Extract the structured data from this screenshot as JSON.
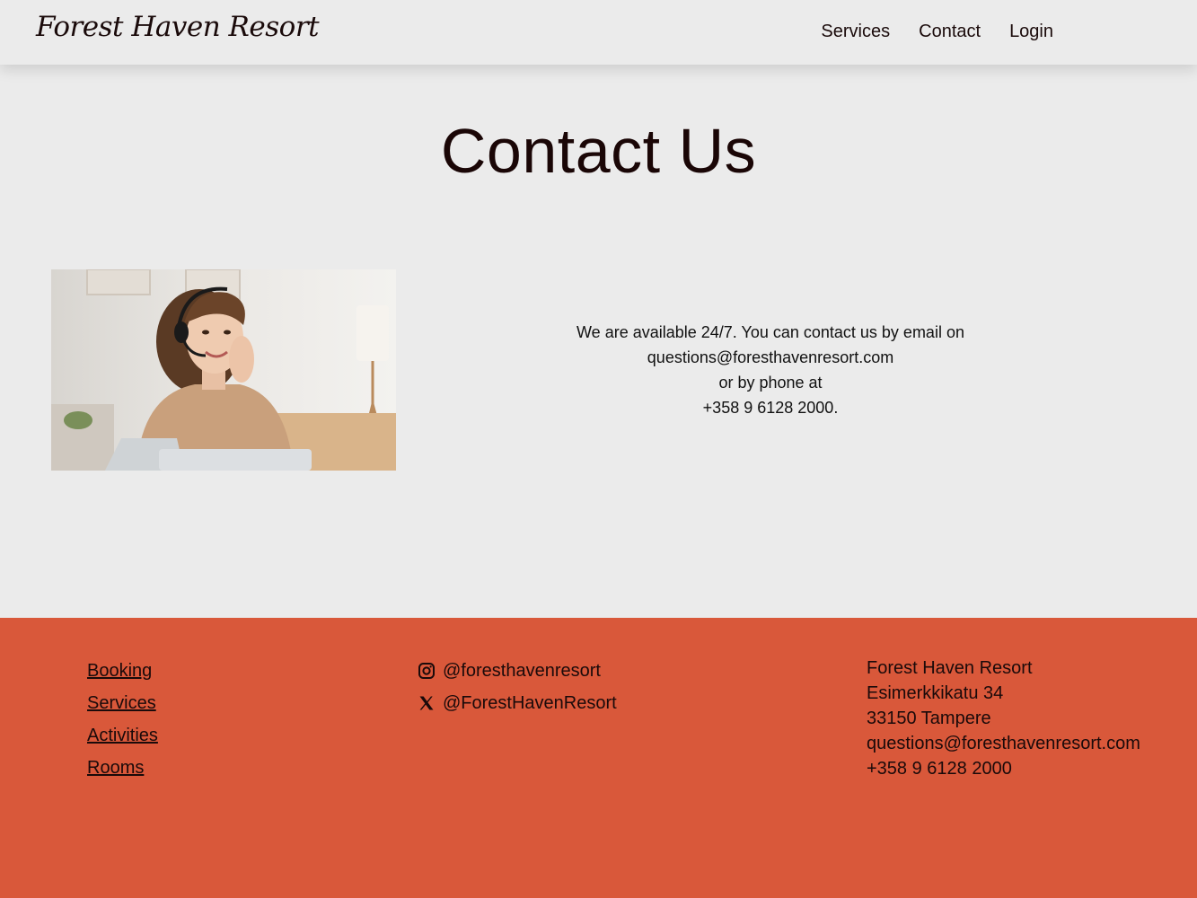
{
  "header": {
    "logo": "Forest Haven Resort",
    "nav": [
      "Services",
      "Contact",
      "Login"
    ]
  },
  "main": {
    "title": "Contact Us",
    "text": {
      "line1": "We are available 24/7. You can contact us by email on",
      "line2": "questions@foresthavenresort.com",
      "line3": "or by phone at",
      "line4": "+358 9 6128 2000."
    }
  },
  "footer": {
    "links": [
      "Booking",
      "Services",
      "Activities",
      "Rooms"
    ],
    "social": [
      {
        "icon": "instagram-icon",
        "handle": "@foresthavenresort"
      },
      {
        "icon": "x-icon",
        "handle": "@ForestHavenResort"
      }
    ],
    "address": {
      "name": "Forest Haven Resort",
      "street": "Esimerkkikatu 34",
      "city": "33150 Tampere",
      "email": "questions@foresthavenresort.com",
      "phone": "+358 9 6128 2000"
    }
  },
  "colors": {
    "background": "#ebebeb",
    "footer": "#d9583a",
    "text": "#1a0a0a"
  }
}
